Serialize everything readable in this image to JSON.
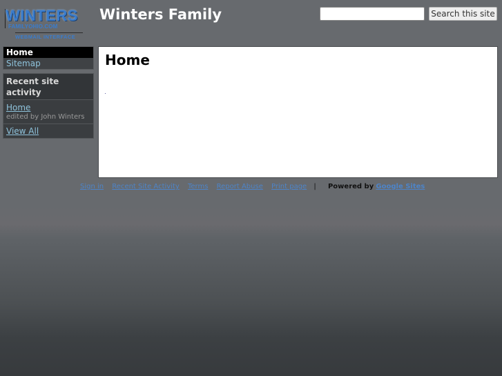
{
  "header": {
    "logo": {
      "main": "WINTERS",
      "sub": "FAMILYOHIO.COM",
      "tagline": "WEBMAIL INTERFACE"
    },
    "site_title": "Winters Family",
    "search": {
      "value": "",
      "placeholder": "",
      "button_label": "Search this site"
    }
  },
  "sidebar": {
    "nav": [
      {
        "label": "Home",
        "active": true
      },
      {
        "label": "Sitemap",
        "active": false
      }
    ],
    "recent_activity": {
      "title": "Recent site activity",
      "entries": [
        {
          "link": "Home",
          "meta": "edited by John Winters"
        }
      ],
      "view_all": "View All"
    }
  },
  "main": {
    "heading": "Home"
  },
  "footer": {
    "links": [
      "Sign in",
      "Recent Site Activity",
      "Terms",
      "Report Abuse",
      "Print page"
    ],
    "separator": "|",
    "powered_by": "Powered by",
    "powered_link": "Google Sites"
  },
  "colors": {
    "link": "#8fc3dc",
    "footer_link": "#4d84c8",
    "nav_active_bg": "#000000"
  }
}
